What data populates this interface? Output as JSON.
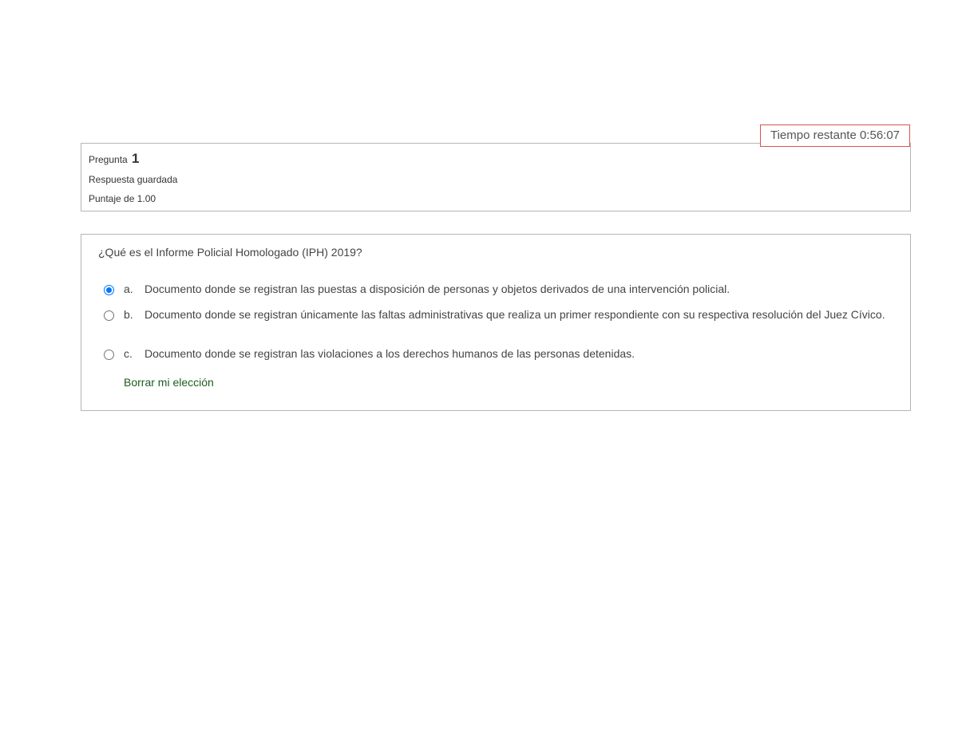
{
  "timer": {
    "label": "Tiempo restante 0:56:07"
  },
  "question_info": {
    "title_label": "Pregunta",
    "number": "1",
    "state": "Respuesta guardada",
    "grade": "Puntaje de 1.00"
  },
  "question": {
    "text": "¿Qué es el Informe Policial Homologado (IPH) 2019?",
    "options": [
      {
        "letter": "a.",
        "text": "Documento donde se registran las puestas a disposición de personas y objetos derivados de una intervención policial.",
        "selected": true
      },
      {
        "letter": "b.",
        "text": "Documento donde se registran únicamente las faltas administrativas que realiza un primer respondiente con su respectiva resolución del Juez Cívico.",
        "selected": false
      },
      {
        "letter": "c.",
        "text": "Documento donde se registran las violaciones a los derechos humanos de las personas detenidas.",
        "selected": false
      }
    ],
    "clear_label": "Borrar mi elección"
  },
  "colors": {
    "timer_border": "#d9534f",
    "radio_selected": "#0075ff",
    "link": "#1d5d1d",
    "box_border": "#b5b5b5"
  }
}
